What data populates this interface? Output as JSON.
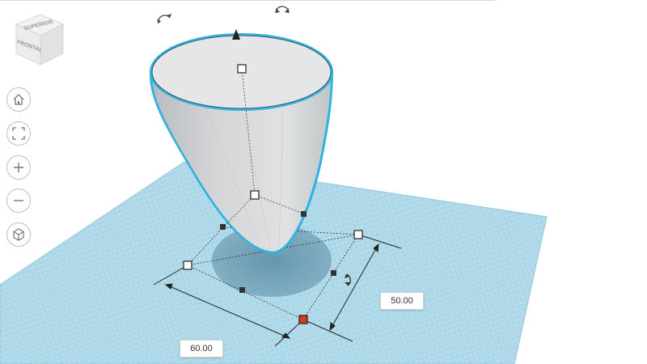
{
  "view_cube": {
    "top_label": "SUPERIOR",
    "front_label": "FRONTAL"
  },
  "toolbar": {
    "buttons": [
      {
        "name": "home",
        "icon": "home-icon"
      },
      {
        "name": "fit",
        "icon": "fit-view-icon"
      },
      {
        "name": "zoom-in",
        "icon": "plus-icon"
      },
      {
        "name": "zoom-out",
        "icon": "minus-icon"
      },
      {
        "name": "perspective",
        "icon": "perspective-cube-icon"
      }
    ]
  },
  "dimensions": {
    "width": "60.00",
    "depth": "50.00"
  },
  "colors": {
    "grid": "#a9d5e6",
    "grid_line": "#7fbfd8",
    "selection": "#2db3e2",
    "shape_fill": "#d8dadc",
    "active_handle": "#d43a1e"
  }
}
